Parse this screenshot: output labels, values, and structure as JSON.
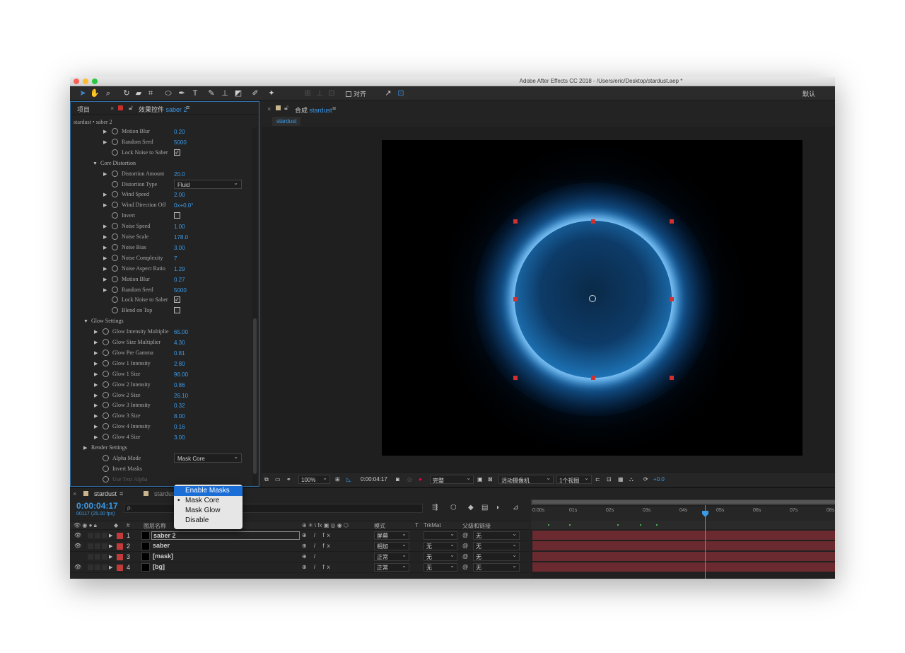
{
  "window": {
    "title": "Adobe After Effects CC 2018 - /Users/eric/Desktop/stardust.aep *"
  },
  "toolbar": {
    "snapping_label": "对齐",
    "workspace": "默认"
  },
  "left_panel": {
    "tab_project": "项目",
    "tab_effects_prefix": "效果控件",
    "tab_effects_layer": "saber 2",
    "breadcrumb": "stardust • saber 2",
    "properties": [
      {
        "name": "Motion Blur",
        "value": "0.20",
        "indent": 2,
        "arrow": true
      },
      {
        "name": "Random Seed",
        "value": "5000",
        "indent": 2,
        "arrow": true
      },
      {
        "name": "Lock Noise to Saber",
        "check": "✓",
        "indent": 2,
        "arrow": false
      },
      {
        "name": "Core Distortion",
        "group": true,
        "indent": 1,
        "open": true
      },
      {
        "name": "Distortion Amount",
        "value": "20.0",
        "indent": 2,
        "arrow": true
      },
      {
        "name": "Distortion Type",
        "dropdown": "Fluid",
        "indent": 2,
        "arrow": false
      },
      {
        "name": "Wind Speed",
        "value": "2.00",
        "indent": 2,
        "arrow": true
      },
      {
        "name": "Wind Direction Off",
        "value": "0x+0.0°",
        "indent": 2,
        "arrow": true
      },
      {
        "name": "Invert",
        "check": "",
        "indent": 2,
        "arrow": false
      },
      {
        "name": "Noise Speed",
        "value": "1.00",
        "indent": 2,
        "arrow": true
      },
      {
        "name": "Noise Scale",
        "value": "178.0",
        "indent": 2,
        "arrow": true
      },
      {
        "name": "Noise Bias",
        "value": "3.00",
        "indent": 2,
        "arrow": true
      },
      {
        "name": "Noise Complexity",
        "value": "7",
        "indent": 2,
        "arrow": true
      },
      {
        "name": "Noise Aspect Ratio",
        "value": "1.29",
        "indent": 2,
        "arrow": true
      },
      {
        "name": "Motion Blur",
        "value": "0.27",
        "indent": 2,
        "arrow": true
      },
      {
        "name": "Random Seed",
        "value": "5000",
        "indent": 2,
        "arrow": true
      },
      {
        "name": "Lock Noise to Saber",
        "check": "✓",
        "indent": 2,
        "arrow": false
      },
      {
        "name": "Blend on Top",
        "check": "",
        "indent": 2,
        "arrow": false
      },
      {
        "name": "Glow Settings",
        "group": true,
        "indent": 0,
        "open": true
      },
      {
        "name": "Glow Intensity Multiplie",
        "value": "65.00",
        "indent": 1,
        "arrow": true
      },
      {
        "name": "Glow Size Multiplier",
        "value": "4.30",
        "indent": 1,
        "arrow": true
      },
      {
        "name": "Glow Pre Gamma",
        "value": "0.81",
        "indent": 1,
        "arrow": true
      },
      {
        "name": "Glow 1 Intensity",
        "value": "2.80",
        "indent": 1,
        "arrow": true
      },
      {
        "name": "Glow 1 Size",
        "value": "96.00",
        "indent": 1,
        "arrow": true
      },
      {
        "name": "Glow 2 Intensity",
        "value": "0.86",
        "indent": 1,
        "arrow": true
      },
      {
        "name": "Glow 2 Size",
        "value": "26.10",
        "indent": 1,
        "arrow": true
      },
      {
        "name": "Glow 3 Intensity",
        "value": "0.32",
        "indent": 1,
        "arrow": true
      },
      {
        "name": "Glow 3 Size",
        "value": "8.00",
        "indent": 1,
        "arrow": true
      },
      {
        "name": "Glow 4 Intensity",
        "value": "0.16",
        "indent": 1,
        "arrow": true
      },
      {
        "name": "Glow 4 Size",
        "value": "3.00",
        "indent": 1,
        "arrow": true
      },
      {
        "name": "Render Settings",
        "group": true,
        "indent": 0,
        "open": false
      },
      {
        "name": "Alpha Mode",
        "dropdown": "Mask Core",
        "indent": 1,
        "arrow": false
      },
      {
        "name": "Invert Masks",
        "indent": 1,
        "arrow": false
      },
      {
        "name": "Use Text Alpha",
        "indent": 1,
        "arrow": false,
        "dim": true
      }
    ],
    "popup_options": [
      "Enable Masks",
      "Mask Core",
      "Mask Glow",
      "Disable"
    ],
    "popup_highlighted": "Enable Masks",
    "popup_checked": "Mask Core"
  },
  "comp_panel": {
    "tab_prefix": "合成",
    "tab_name": "stardust",
    "view_pill": "stardust",
    "footer": {
      "zoom": "100%",
      "time": "0:00:04:17",
      "resolution": "完整",
      "camera": "活动摄像机",
      "views": "1个视图",
      "exposure": "+0.0"
    }
  },
  "timeline": {
    "tab1": "stardust",
    "tab2": "stardust",
    "timecode": "0:00:04:17",
    "frames": "00117 (25.00 fps)",
    "search_placeholder": "ρ.",
    "columns": {
      "source_name": "图层名称",
      "mode": "模式",
      "t": "T",
      "trkmat": "TrkMat",
      "parent": "父级和链接"
    },
    "ruler": [
      "0:00s",
      "01s",
      "02s",
      "03s",
      "04s",
      "05s",
      "06s",
      "07s",
      "08s"
    ],
    "layers": [
      {
        "num": "1",
        "name": "saber 2",
        "mode": "屏幕",
        "trkmat": "",
        "parent": "无",
        "fx": true,
        "eye": true,
        "selected": true
      },
      {
        "num": "2",
        "name": "saber",
        "mode": "相加",
        "trkmat": "无",
        "parent": "无",
        "fx": true,
        "eye": true,
        "selected": false
      },
      {
        "num": "3",
        "name": "[mask]",
        "mode": "正常",
        "trkmat": "无",
        "parent": "无",
        "fx": false,
        "eye": false,
        "selected": false
      },
      {
        "num": "4",
        "name": "[bg]",
        "mode": "正常",
        "trkmat": "无",
        "parent": "无",
        "fx": true,
        "eye": true,
        "selected": false
      }
    ]
  },
  "colors": {
    "accent": "#3a9ae8",
    "label_red": "#c23b3b",
    "layer_bar": "#6b2a2f",
    "popup_highlight": "#1b6ed6"
  }
}
